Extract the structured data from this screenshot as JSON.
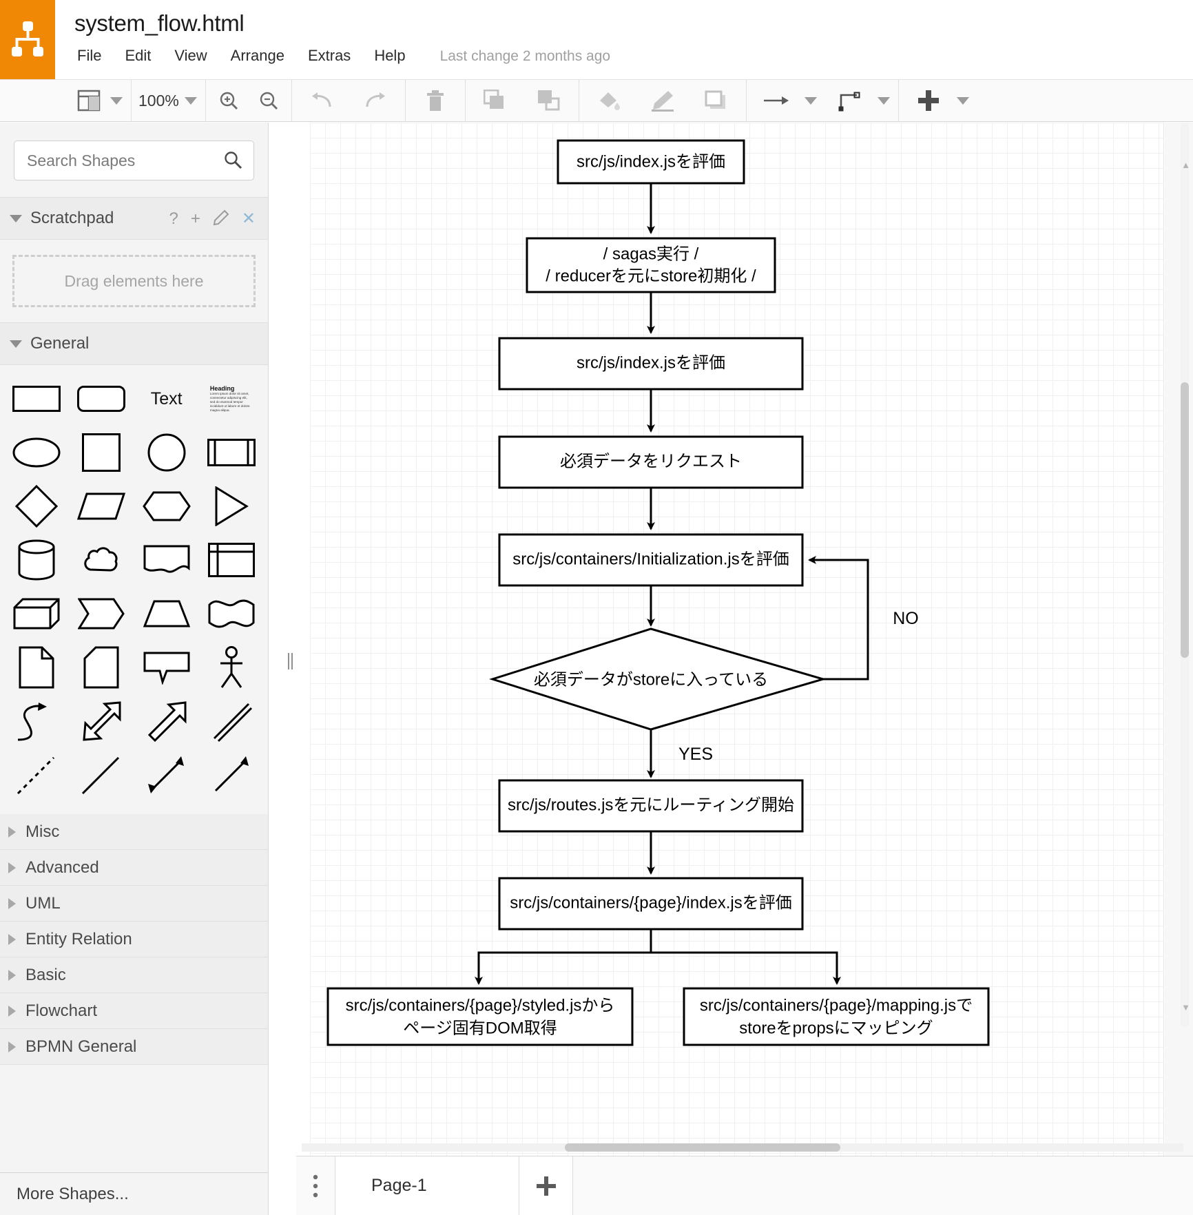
{
  "app": {
    "logo_icon": "drawio-logo-icon",
    "title": "system_flow.html",
    "menu": [
      "File",
      "Edit",
      "View",
      "Arrange",
      "Extras",
      "Help"
    ],
    "last_change": "Last change 2 months ago"
  },
  "toolbar": {
    "view_icon": "layout-panels-icon",
    "zoom_level": "100%",
    "zoom_in_icon": "zoom-in-icon",
    "zoom_out_icon": "zoom-out-icon",
    "undo_icon": "undo-icon",
    "redo_icon": "redo-icon",
    "delete_icon": "trash-icon",
    "to_front_icon": "bring-to-front-icon",
    "to_back_icon": "send-to-back-icon",
    "fill_icon": "fill-color-icon",
    "line_icon": "line-color-icon",
    "shadow_icon": "shadow-icon",
    "connection_icon": "arrow-connection-icon",
    "waypoint_icon": "waypoint-icon",
    "insert_icon": "plus-insert-icon"
  },
  "sidebar": {
    "search": {
      "placeholder": "Search Shapes",
      "value": "",
      "icon": "search-icon"
    },
    "scratchpad": {
      "label": "Scratchpad",
      "help_icon": "question-icon",
      "add_icon": "plus-icon",
      "edit_icon": "pencil-icon",
      "close_icon": "close-icon",
      "drop_hint": "Drag elements here"
    },
    "general": {
      "label": "General",
      "shapes": [
        "rectangle-shape",
        "rounded-rectangle-shape",
        "text-shape",
        "textbox-shape",
        "ellipse-shape",
        "square-shape",
        "circle-shape",
        "process-shape",
        "diamond-shape",
        "parallelogram-shape",
        "hexagon-shape",
        "triangle-shape",
        "cylinder-shape",
        "cloud-shape",
        "document-shape",
        "internal-storage-shape",
        "cube-shape",
        "step-shape",
        "trapezoid-shape",
        "tape-shape",
        "note-shape",
        "card-shape",
        "callout-shape",
        "actor-shape",
        "curve-shape",
        "double-arrow-shape",
        "single-arrow-shape",
        "link-shape",
        "dashed-line-shape",
        "plain-line-shape",
        "bidirectional-arrow-shape",
        "directional-arrow-shape"
      ],
      "text_shape_label": "Text",
      "textbox_heading": "Heading",
      "textbox_body": "Lorem ipsum dolor sit amet, consectetur adipiscing elit, sed do eiusmod tempor incididunt ut labore et dolore magna aliqua."
    },
    "categories": [
      "Misc",
      "Advanced",
      "UML",
      "Entity Relation",
      "Basic",
      "Flowchart",
      "BPMN General"
    ],
    "more_shapes": "More Shapes..."
  },
  "footer": {
    "menu_icon": "page-menu-icon",
    "page_name": "Page-1",
    "add_page_icon": "plus-icon"
  },
  "chart_data": {
    "type": "flowchart",
    "title": "system_flow",
    "nodes": [
      {
        "id": "n1",
        "label": "src/js/index.jsを評価",
        "shape": "rectangle"
      },
      {
        "id": "n2",
        "label_line1": "/ sagas実行 /",
        "label_line2": "/ reducerを元にstore初期化 /",
        "shape": "rectangle"
      },
      {
        "id": "n3",
        "label": "src/js/index.jsを評価",
        "shape": "rectangle"
      },
      {
        "id": "n4",
        "label": "必須データをリクエスト",
        "shape": "rectangle"
      },
      {
        "id": "n5",
        "label": "src/js/containers/Initialization.jsを評価",
        "shape": "rectangle"
      },
      {
        "id": "n6",
        "label": "必須データがstoreに入っている",
        "shape": "diamond"
      },
      {
        "id": "n7",
        "label": "src/js/routes.jsを元にルーティング開始",
        "shape": "rectangle"
      },
      {
        "id": "n8",
        "label": "src/js/containers/{page}/index.jsを評価",
        "shape": "rectangle"
      },
      {
        "id": "n9",
        "label_line1": "src/js/containers/{page}/styled.jsから",
        "label_line2": "ページ固有DOM取得",
        "shape": "rectangle"
      },
      {
        "id": "n10",
        "label_line1": "src/js/containers/{page}/mapping.jsで",
        "label_line2": "storeをpropsにマッピング",
        "shape": "rectangle"
      }
    ],
    "edges": [
      {
        "from": "n1",
        "to": "n2",
        "label": ""
      },
      {
        "from": "n2",
        "to": "n3",
        "label": ""
      },
      {
        "from": "n3",
        "to": "n4",
        "label": ""
      },
      {
        "from": "n4",
        "to": "n5",
        "label": ""
      },
      {
        "from": "n5",
        "to": "n6",
        "label": ""
      },
      {
        "from": "n6",
        "to": "n5",
        "label": "NO"
      },
      {
        "from": "n6",
        "to": "n7",
        "label": "YES"
      },
      {
        "from": "n7",
        "to": "n8",
        "label": ""
      },
      {
        "from": "n8",
        "to": "n9",
        "label": ""
      },
      {
        "from": "n8",
        "to": "n10",
        "label": ""
      }
    ],
    "edge_labels": {
      "no": "NO",
      "yes": "YES"
    }
  }
}
